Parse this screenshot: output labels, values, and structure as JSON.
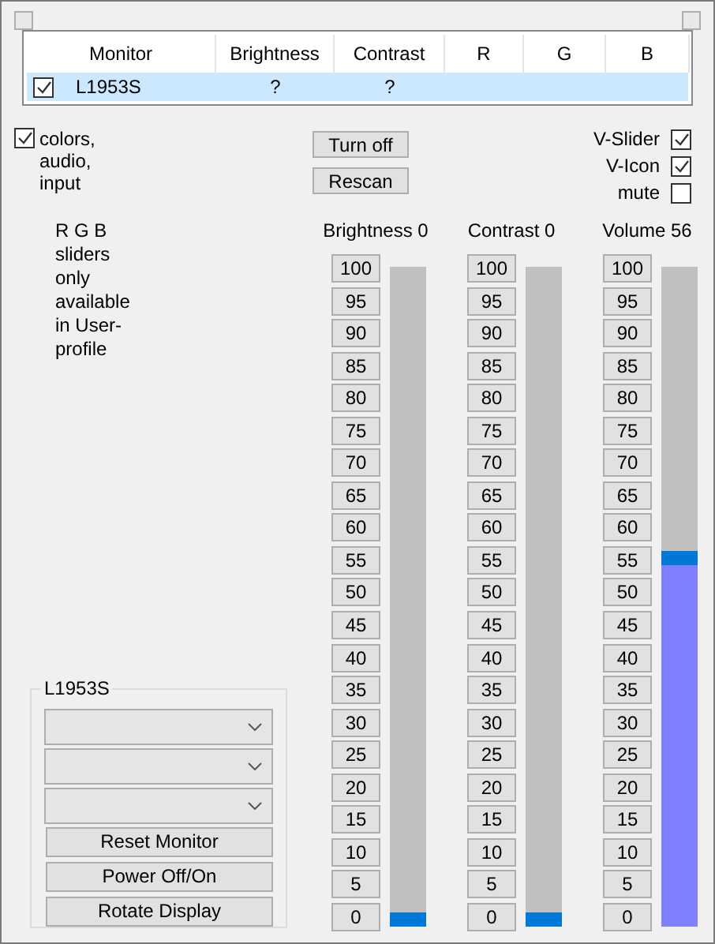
{
  "table": {
    "columns": [
      "Monitor",
      "Brightness",
      "Contrast",
      "R",
      "G",
      "B"
    ],
    "rows": [
      {
        "checked": true,
        "selected": true,
        "cells": [
          "L1953S",
          "?",
          "?"
        ]
      }
    ]
  },
  "options": {
    "label": "colors, audio, input",
    "checked": true
  },
  "buttons": [
    "Turn off",
    "Rescan"
  ],
  "toggles": [
    {
      "label": "V-Slider",
      "checked": true
    },
    {
      "label": "V-Icon",
      "checked": true
    },
    {
      "label": "mute",
      "checked": false
    }
  ],
  "note": "R G B sliders only available in User-profile",
  "sliders": [
    {
      "label": "Brightness 0",
      "level": 0,
      "steps": [
        "100",
        "95",
        "90",
        "85",
        "80",
        "75",
        "70",
        "65",
        "60",
        "55",
        "50",
        "45",
        "40",
        "35",
        "30",
        "25",
        "20",
        "15",
        "10",
        "5",
        "0"
      ]
    },
    {
      "label": "Contrast 0",
      "level": 0,
      "steps": [
        "100",
        "95",
        "90",
        "85",
        "80",
        "75",
        "70",
        "65",
        "60",
        "55",
        "50",
        "45",
        "40",
        "35",
        "30",
        "25",
        "20",
        "15",
        "10",
        "5",
        "0"
      ]
    },
    {
      "label": "Volume 56",
      "level": 0.56,
      "steps": [
        "100",
        "95",
        "90",
        "85",
        "80",
        "75",
        "70",
        "65",
        "60",
        "55",
        "50",
        "45",
        "40",
        "35",
        "30",
        "25",
        "20",
        "15",
        "10",
        "5",
        "0"
      ]
    }
  ],
  "monitor_group": {
    "title": "L1953S",
    "buttons": [
      "Reset Monitor",
      "Power Off/On",
      "Rotate Display"
    ]
  }
}
